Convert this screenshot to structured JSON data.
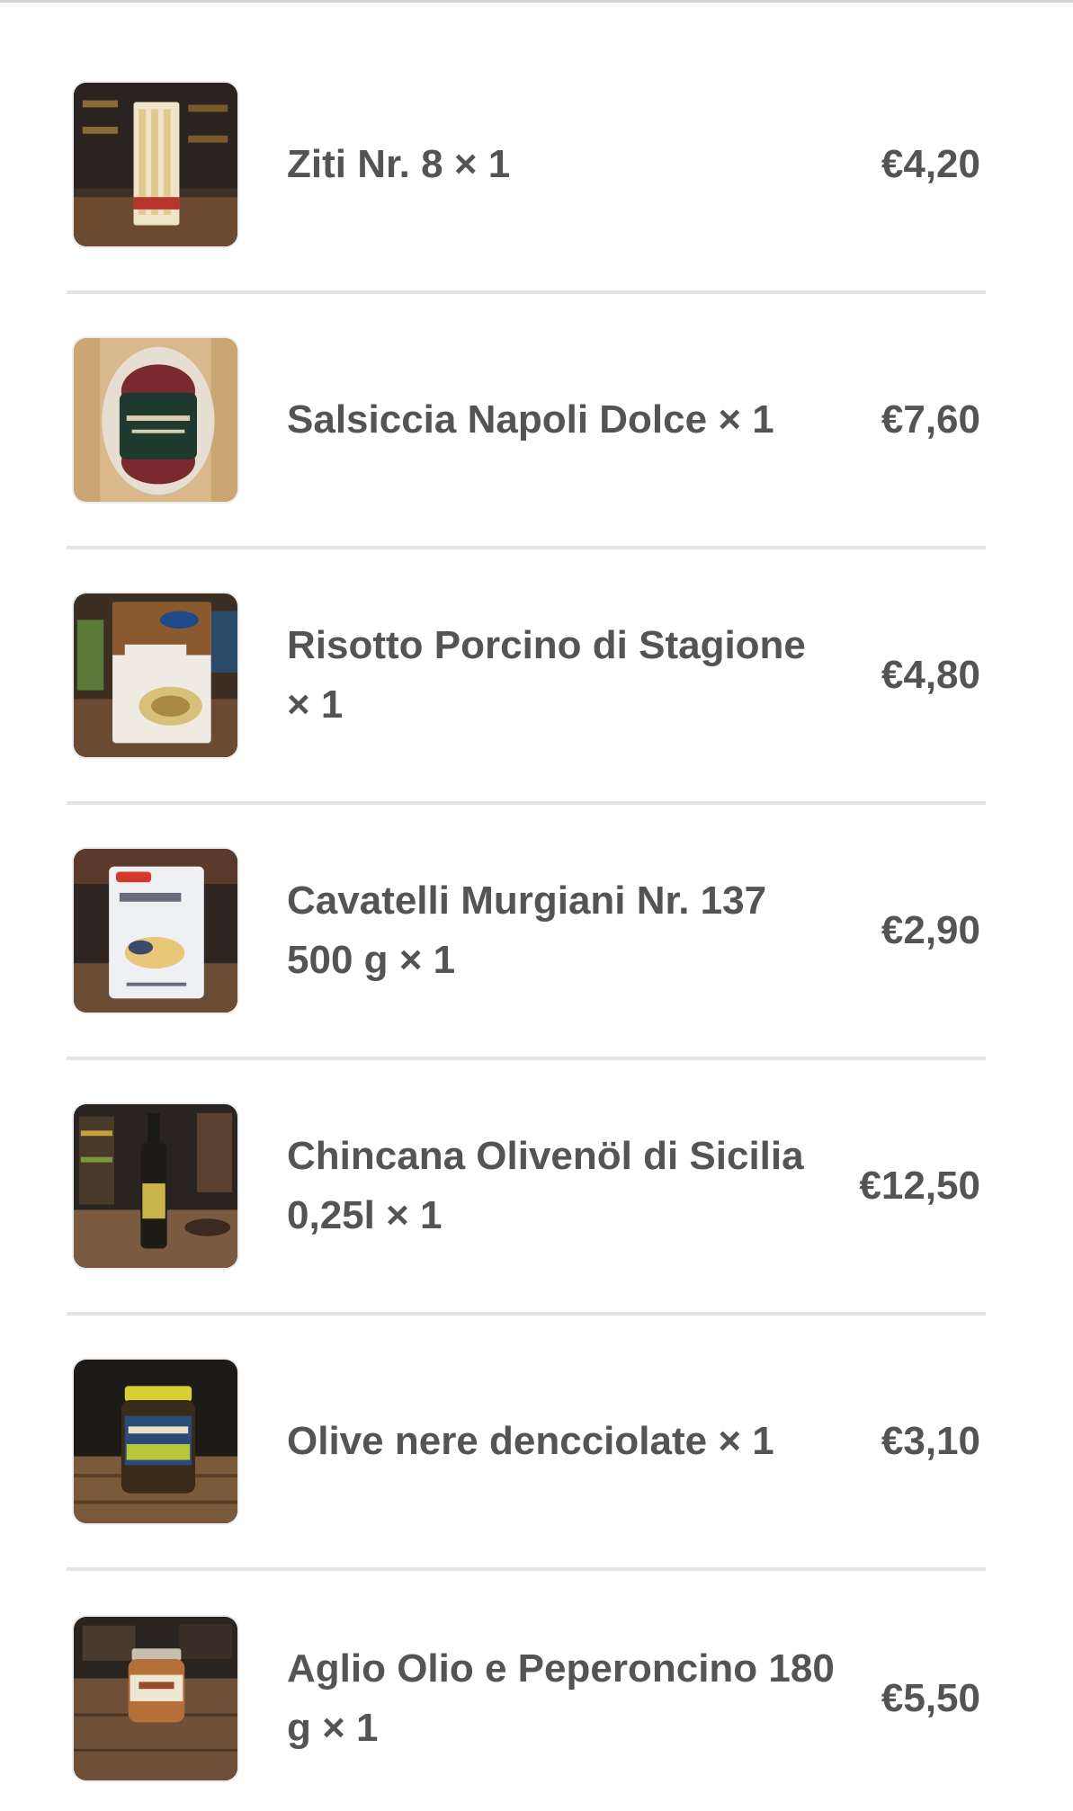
{
  "order_items": [
    {
      "name": "Ziti Nr. 8 × 1",
      "price": "€4,20",
      "image_icon": "pasta-package-photo"
    },
    {
      "name": "Salsiccia Napoli Dolce × 1",
      "price": "€7,60",
      "image_icon": "sausage-package-photo"
    },
    {
      "name": "Risotto Porcino di Stagione × 1",
      "price": "€4,80",
      "image_icon": "risotto-package-photo"
    },
    {
      "name": "Cavatelli Murgiani Nr. 137 500 g × 1",
      "price": "€2,90",
      "image_icon": "cavatelli-package-photo"
    },
    {
      "name": "Chincana Olivenöl di Sicilia 0,25l × 1",
      "price": "€12,50",
      "image_icon": "olive-oil-bottle-photo"
    },
    {
      "name": "Olive nere dencciolate × 1",
      "price": "€3,10",
      "image_icon": "olive-jar-photo"
    },
    {
      "name": "Aglio Olio e Peperoncino 180 g × 1",
      "price": "€5,50",
      "image_icon": "sauce-jar-photo"
    }
  ],
  "colors": {
    "text": "#545454",
    "divider": "#e5e5e5",
    "background": "#ffffff"
  }
}
